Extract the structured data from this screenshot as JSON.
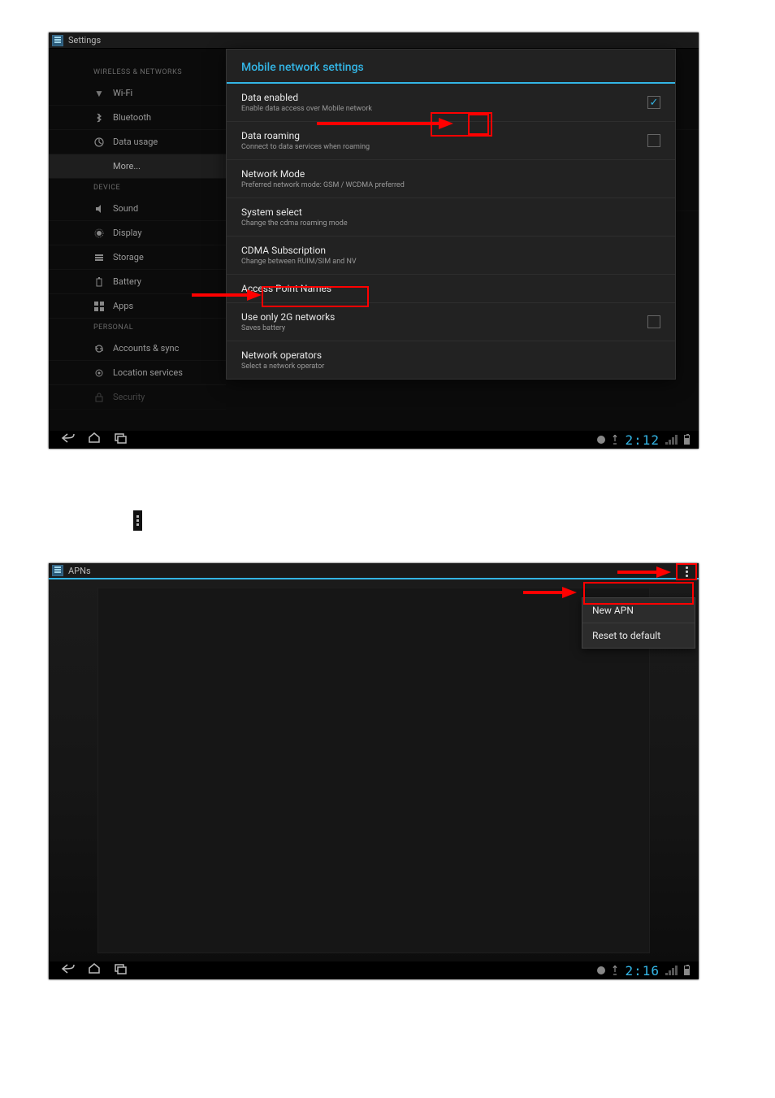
{
  "screenshot1": {
    "topbar_title": "Settings",
    "sidebar": {
      "sections": [
        {
          "header": "WIRELESS & NETWORKS",
          "items": [
            {
              "icon": "wifi-icon",
              "label": "Wi-Fi"
            },
            {
              "icon": "bluetooth-icon",
              "label": "Bluetooth"
            },
            {
              "icon": "datausage-icon",
              "label": "Data usage"
            },
            {
              "icon": "",
              "label": "More...",
              "active": true
            }
          ]
        },
        {
          "header": "DEVICE",
          "items": [
            {
              "icon": "sound-icon",
              "label": "Sound"
            },
            {
              "icon": "display-icon",
              "label": "Display"
            },
            {
              "icon": "storage-icon",
              "label": "Storage"
            },
            {
              "icon": "battery-icon",
              "label": "Battery"
            },
            {
              "icon": "apps-icon",
              "label": "Apps"
            }
          ]
        },
        {
          "header": "PERSONAL",
          "items": [
            {
              "icon": "sync-icon",
              "label": "Accounts & sync"
            },
            {
              "icon": "location-icon",
              "label": "Location services"
            },
            {
              "icon": "security-icon",
              "label": "Security"
            }
          ]
        }
      ]
    },
    "dialog": {
      "title": "Mobile network settings",
      "items": [
        {
          "label": "Data enabled",
          "sub": "Enable data access over Mobile network",
          "check": "on"
        },
        {
          "label": "Data roaming",
          "sub": "Connect to data services when roaming",
          "check": "off"
        },
        {
          "label": "Network Mode",
          "sub": "Preferred network mode: GSM / WCDMA preferred"
        },
        {
          "label": "System select",
          "sub": "Change the cdma roaming mode"
        },
        {
          "label": "CDMA Subscription",
          "sub": "Change between RUIM/SIM and NV"
        },
        {
          "label": "Access Point Names"
        },
        {
          "label": "Use only 2G networks",
          "sub": "Saves battery",
          "check": "off"
        },
        {
          "label": "Network operators",
          "sub": "Select a network operator"
        }
      ]
    },
    "sysbar_time": "2:12"
  },
  "screenshot2": {
    "topbar_title": "APNs",
    "menu": {
      "items": [
        {
          "label": "New APN"
        },
        {
          "label": "Reset to default"
        }
      ]
    },
    "sysbar_time": "2:16"
  }
}
